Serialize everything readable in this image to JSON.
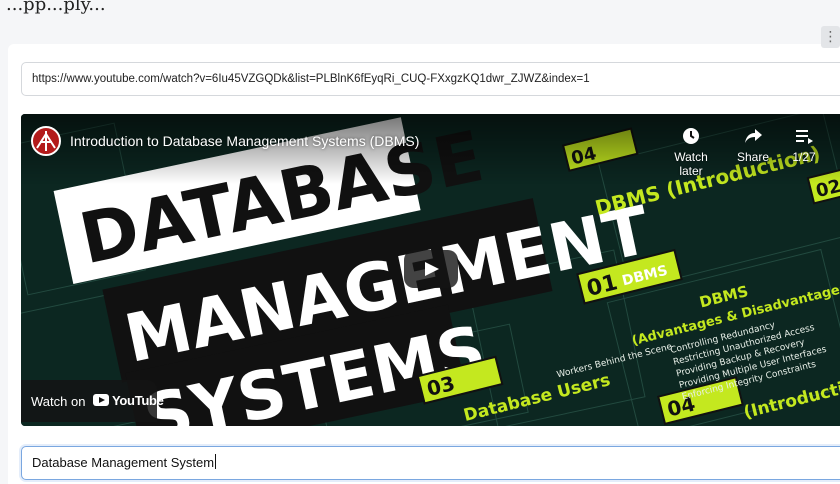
{
  "header": {
    "text": "...pp...ply..."
  },
  "menu": {
    "kebab_label": "⋮"
  },
  "url_field": {
    "value": "https://www.youtube.com/watch?v=6Iu45VZGQDk&list=PLBlnK6fEyqRi_CUQ-FXxgzKQ1dwr_ZJWZ&index=1"
  },
  "video": {
    "title": "Introduction to Database Management Systems (DBMS)",
    "watch_later": "Watch later",
    "share": "Share",
    "playlist_count": "1/27",
    "thumbnail": {
      "headline_1": "DATABASE",
      "headline_2": "MANAGEMENT",
      "headline_3": "SYSTEMS",
      "side_label": "DBMS (Introduction)",
      "badge_01": "01",
      "badge_02": "02",
      "badge_03": "03",
      "badge_04a": "04",
      "badge_04b": "04",
      "badge_word": "DBMS",
      "card_title": "DBMS",
      "card_subtitle": "(Advantages & Disadvantages)",
      "card_items": [
        "Controlling Redundancy",
        "Restricting Unauthorized Access",
        "Providing Backup & Recovery",
        "Providing Multiple User Interfaces",
        "Enforcing Integrity Constraints"
      ],
      "users_title": "Database Users",
      "users_sub": "Workers Behind the Scene",
      "bottom_right": "(Introduction)"
    },
    "watch_on": "Watch on",
    "watch_on_brand": "YouTube"
  },
  "search_field": {
    "value": "Database Management System"
  },
  "colors": {
    "accent_green": "#c4e81f",
    "dark_bg": "#0d2a23",
    "focus_border": "#7aa7e0"
  }
}
